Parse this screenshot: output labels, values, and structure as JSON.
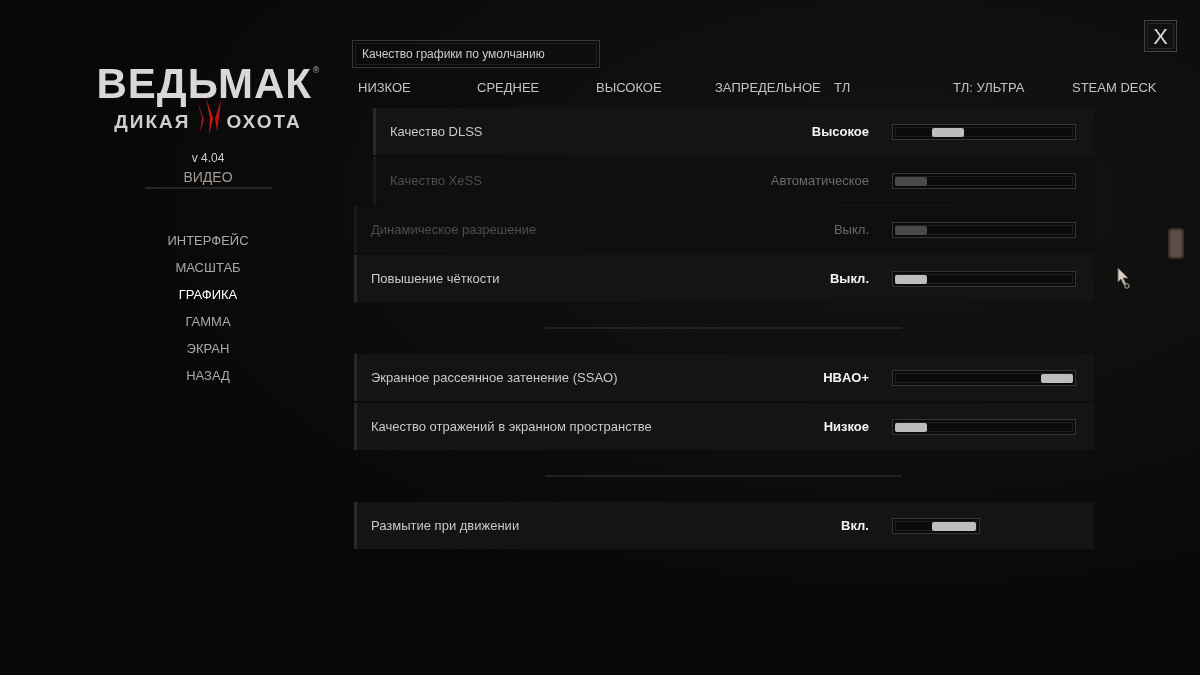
{
  "sidebar": {
    "logo": {
      "title": "ВЕДЬМАК",
      "mark": "®",
      "subtitle_left": "ДИКАЯ",
      "subtitle_right": "ОХОТА"
    },
    "version": "v 4.04",
    "section_title": "ВИДЕО",
    "menu": [
      {
        "label": "ИНТЕРФЕЙС",
        "selected": false
      },
      {
        "label": "МАСШТАБ",
        "selected": false
      },
      {
        "label": "ГРАФИКА",
        "selected": true
      },
      {
        "label": "ГАММА",
        "selected": false
      },
      {
        "label": "ЭКРАН",
        "selected": false
      },
      {
        "label": "НАЗАД",
        "selected": false
      }
    ]
  },
  "preset": {
    "value": "Качество графики по умолчанию",
    "options": [
      {
        "label": "НИЗКОЕ",
        "selected": false
      },
      {
        "label": "СРЕДНЕЕ",
        "selected": false
      },
      {
        "label": "ВЫСОКОЕ",
        "selected": false
      },
      {
        "label": "ЗАПРЕДЕЛЬНОЕ",
        "selected": false
      },
      {
        "label": "ТЛ",
        "selected": false
      },
      {
        "label": "ТЛ: УЛЬТРА",
        "selected": false
      },
      {
        "label": "STEAM DECK",
        "selected": false
      }
    ]
  },
  "settings": {
    "sections": [
      {
        "rows": [
          {
            "kind": "group",
            "children": [
              {
                "kind": "slider",
                "label": "Качество DLSS",
                "value": "Высокое",
                "disabled": false,
                "level": 0.25
              },
              {
                "kind": "slider",
                "label": "Качество XeSS",
                "value": "Автоматическое",
                "disabled": true,
                "level": 0
              }
            ]
          },
          {
            "kind": "slider",
            "label": "Динамическое разрешение",
            "value": "Выкл.",
            "disabled": true,
            "level": 0
          },
          {
            "kind": "slider",
            "label": "Повышение чёткости",
            "value": "Выкл.",
            "disabled": false,
            "level": 0
          }
        ]
      },
      {
        "rows": [
          {
            "kind": "slider",
            "label": "Экранное рассеянное затенение (SSAO)",
            "value": "HBAO+",
            "disabled": false,
            "level": 1
          },
          {
            "kind": "slider",
            "label": "Качество отражений в экранном пространстве",
            "value": "Низкое",
            "disabled": false,
            "level": 0
          }
        ]
      },
      {
        "rows": [
          {
            "kind": "toggle",
            "label": "Размытие при движении",
            "value": "Вкл.",
            "disabled": false,
            "on": true
          }
        ]
      }
    ]
  },
  "close_button": {
    "label": "X"
  }
}
